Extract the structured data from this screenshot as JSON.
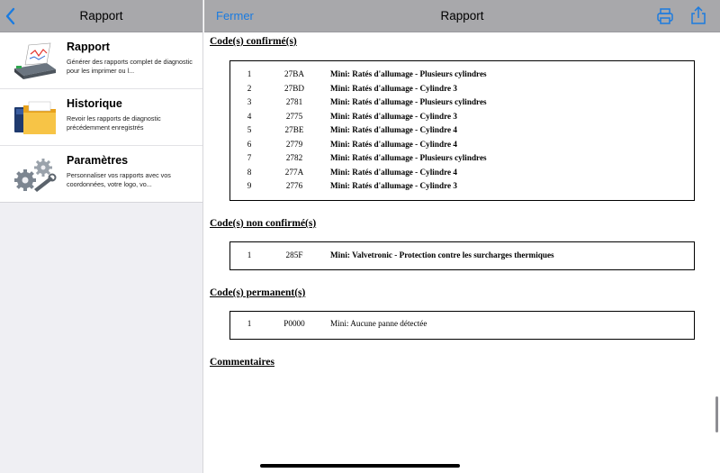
{
  "sidebar": {
    "title": "Rapport",
    "items": [
      {
        "title": "Rapport",
        "description": "Générer des rapports complet de diagnostic pour les imprimer ou l...",
        "icon": "report-printer-icon"
      },
      {
        "title": "Historique",
        "description": "Revoir les rapports de diagnostic précédemment enregistrés",
        "icon": "folder-history-icon"
      },
      {
        "title": "Paramètres",
        "description": "Personnaliser vos rapports avec vos coordonnées, votre logo, vo...",
        "icon": "gears-settings-icon"
      }
    ]
  },
  "main": {
    "close_label": "Fermer",
    "title": "Rapport"
  },
  "report": {
    "confirmed": {
      "title": "Code(s) confirmé(s)",
      "rows": [
        {
          "index": "1",
          "code": "27BA",
          "description": "Mini: Ratés d'allumage - Plusieurs cylindres"
        },
        {
          "index": "2",
          "code": "27BD",
          "description": "Mini: Ratés d'allumage - Cylindre 3"
        },
        {
          "index": "3",
          "code": "2781",
          "description": "Mini: Ratés d'allumage - Plusieurs cylindres"
        },
        {
          "index": "4",
          "code": "2775",
          "description": "Mini: Ratés d'allumage - Cylindre 3"
        },
        {
          "index": "5",
          "code": "27BE",
          "description": "Mini: Ratés d'allumage - Cylindre 4"
        },
        {
          "index": "6",
          "code": "2779",
          "description": "Mini: Ratés d'allumage - Cylindre 4"
        },
        {
          "index": "7",
          "code": "2782",
          "description": "Mini: Ratés d'allumage - Plusieurs cylindres"
        },
        {
          "index": "8",
          "code": "277A",
          "description": "Mini: Ratés d'allumage - Cylindre 4"
        },
        {
          "index": "9",
          "code": "2776",
          "description": "Mini: Ratés d'allumage - Cylindre 3"
        }
      ]
    },
    "unconfirmed": {
      "title": "Code(s) non confirmé(s)",
      "rows": [
        {
          "index": "1",
          "code": "285F",
          "description": "Mini: Valvetronic - Protection contre les surcharges thermiques"
        }
      ]
    },
    "permanent": {
      "title": "Code(s) permanent(s)",
      "rows": [
        {
          "index": "1",
          "code": "P0000",
          "description": "Mini: Aucune panne détectée"
        }
      ]
    },
    "comments_title": "Commentaires"
  },
  "colors": {
    "header_bg": "#a8a8ab",
    "accent": "#1a7be0",
    "sidebar_bg": "#efeff3"
  }
}
